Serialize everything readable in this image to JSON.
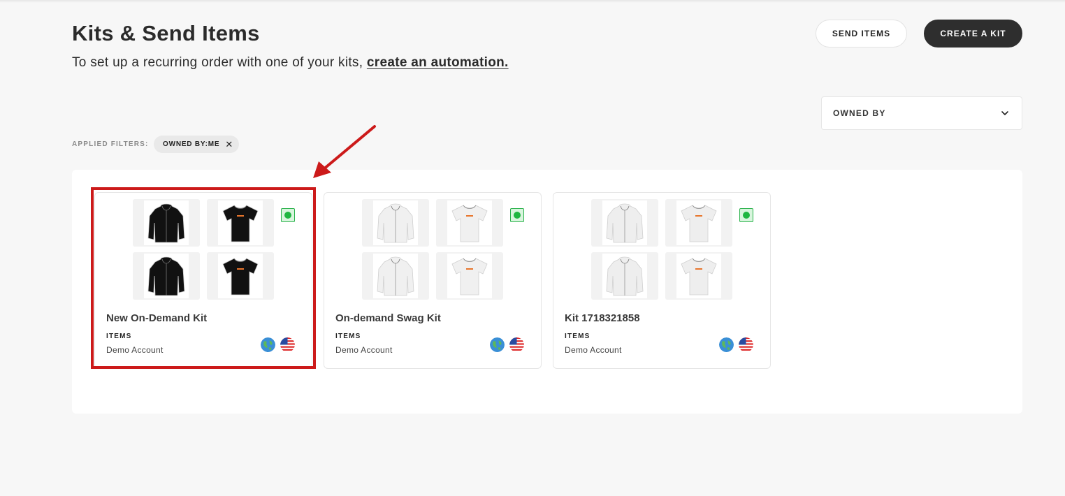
{
  "header": {
    "title": "Kits & Send Items",
    "subtitle_text": "To set up a recurring order with one of your kits,",
    "subtitle_link": "create an automation."
  },
  "actions": {
    "send_items": "SEND ITEMS",
    "create_kit": "CREATE A KIT"
  },
  "owned_by_select": {
    "label": "OWNED BY"
  },
  "filters": {
    "label": "APPLIED FILTERS:",
    "chips": [
      {
        "label": "OWNED BY:ME"
      }
    ]
  },
  "kits": [
    {
      "name": "New On-Demand Kit",
      "items_label": "ITEMS",
      "owner": "Demo Account",
      "status": "active",
      "product_color": "#111111",
      "products": [
        "hoodie-icon",
        "tshirt-icon",
        "hoodie-icon",
        "tshirt-icon"
      ]
    },
    {
      "name": "On-demand Swag Kit",
      "items_label": "ITEMS",
      "owner": "Demo Account",
      "status": "active",
      "product_color": "#f0f0f0",
      "products": [
        "hoodie-icon",
        "tshirt-icon",
        "hoodie-icon",
        "tshirt-icon"
      ]
    },
    {
      "name": "Kit 1718321858",
      "items_label": "ITEMS",
      "owner": "Demo Account",
      "status": "active",
      "product_color": "#eeeeee",
      "products": [
        "hoodie-icon",
        "tshirt-icon",
        "hoodie-icon",
        "tshirt-icon"
      ]
    }
  ],
  "colors": {
    "highlight": "#cc1a1a",
    "status_green": "#1fb641",
    "dark_button": "#2e2e2e"
  }
}
